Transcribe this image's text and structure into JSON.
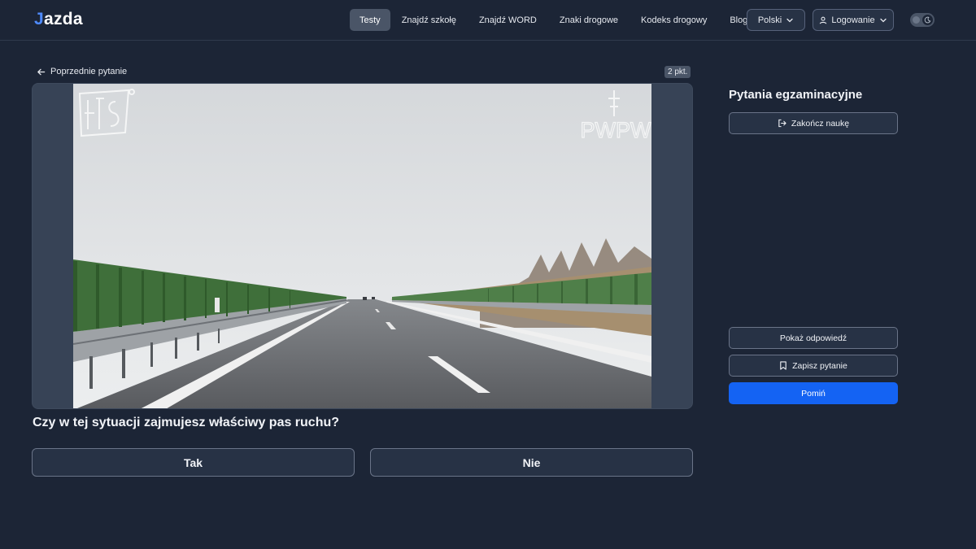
{
  "app": {
    "logo_prefix": "J",
    "logo_rest": "azda"
  },
  "nav": {
    "items": [
      {
        "label": "Testy",
        "active": true
      },
      {
        "label": "Znajdź szkołę",
        "active": false
      },
      {
        "label": "Znajdź WORD",
        "active": false
      },
      {
        "label": "Znaki drogowe",
        "active": false
      },
      {
        "label": "Kodeks drogowy",
        "active": false
      },
      {
        "label": "Blog",
        "active": false
      }
    ],
    "language_label": "Polski",
    "login_label": "Logowanie"
  },
  "question": {
    "prev_label": "Poprzednie pytanie",
    "points": "2 pkt.",
    "text": "Czy w tej sytuacji zajmujesz właściwy pas ruchu?",
    "answers": {
      "yes": "Tak",
      "no": "Nie"
    },
    "media": {
      "watermark_right": "PWPW"
    }
  },
  "side": {
    "title": "Pytania egzaminacyjne",
    "finish_label": "Zakończ naukę",
    "show_answer_label": "Pokaż odpowiedź",
    "save_label": "Zapisz pytanie",
    "skip_label": "Pomiń"
  },
  "colors": {
    "background": "#1c2536",
    "accent": "#1463f3",
    "logo_accent": "#4f8bff"
  }
}
